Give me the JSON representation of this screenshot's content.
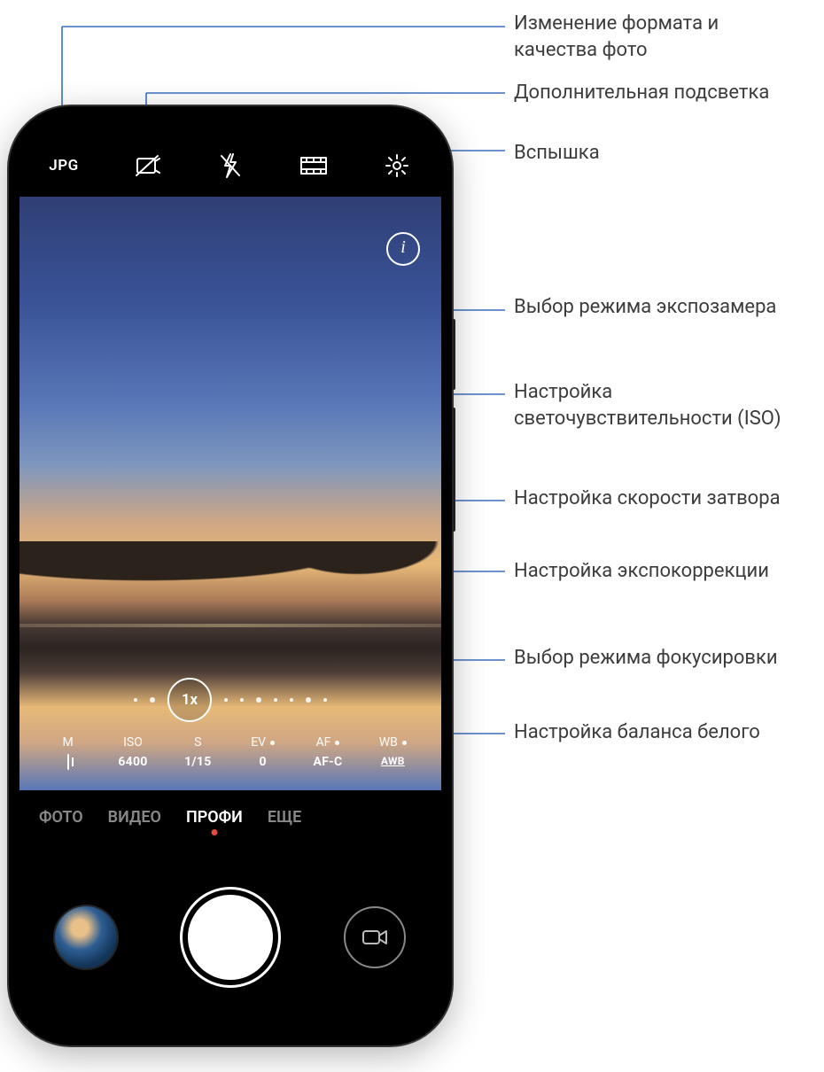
{
  "annotations": {
    "format": "Изменение формата и качества фото",
    "light": "Дополнительная подсветка",
    "flash": "Вспышка",
    "metering": "Выбор режима экспозамера",
    "iso": "Настройка светочувствительности (ISO)",
    "shutter": "Настройка скорости затвора",
    "ev": "Настройка экспокоррекции",
    "focus": "Выбор режима фокусировки",
    "wb": "Настройка баланса белого"
  },
  "topbar": {
    "format_label": "JPG"
  },
  "viewfinder": {
    "zoom_label": "1x",
    "info_label": "i"
  },
  "pro": {
    "m": {
      "label": "M",
      "value_icon": "metering"
    },
    "iso": {
      "label": "ISO",
      "value": "6400"
    },
    "s": {
      "label": "S",
      "value": "1/15"
    },
    "ev": {
      "label": "EV",
      "value": "0"
    },
    "af": {
      "label": "AF",
      "value": "AF-C"
    },
    "wb": {
      "label": "WB",
      "value": "AWB"
    }
  },
  "modes": {
    "photo": "ФОТО",
    "video": "ВИДЕО",
    "pro": "ПРОФИ",
    "more": "ЕЩЕ"
  }
}
